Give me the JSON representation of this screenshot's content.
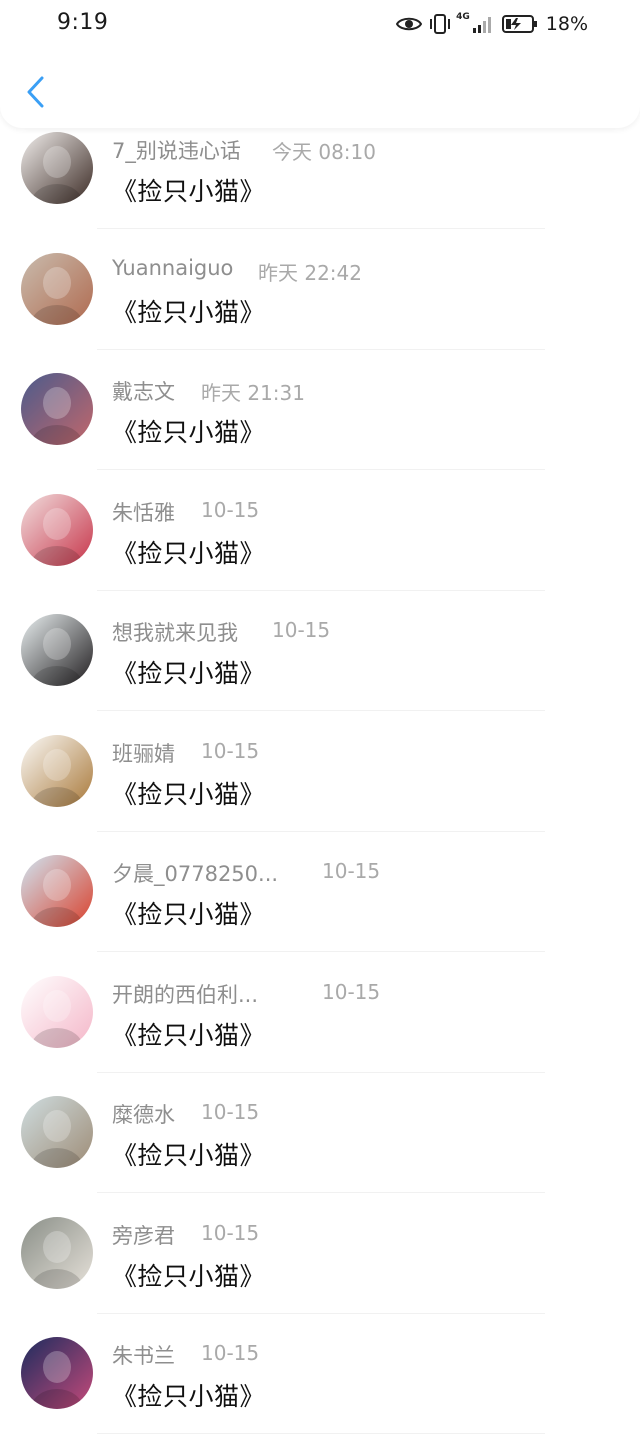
{
  "status_bar": {
    "time": "9:19",
    "network": "4G",
    "battery_percent": "18%"
  },
  "header": {
    "back_icon": "chevron-left-icon",
    "accent_color": "#3a9ff5"
  },
  "items": [
    {
      "name": "7_别说违心话",
      "time": "今天 08:10",
      "message": "《捡只小猫》",
      "avatar_colors": [
        "#f2efed",
        "#3b2a24"
      ]
    },
    {
      "name": "Yuannaiguo",
      "time": "昨天 22:42",
      "message": "《捡只小猫》",
      "avatar_colors": [
        "#c9bcae",
        "#b06a4f"
      ]
    },
    {
      "name": "戴志文",
      "time": "昨天 21:31",
      "message": "《捡只小猫》",
      "avatar_colors": [
        "#4b5b8c",
        "#c2676b"
      ]
    },
    {
      "name": "朱恬雅",
      "time": "10-15",
      "message": "《捡只小猫》",
      "avatar_colors": [
        "#f1dede",
        "#c7354a"
      ]
    },
    {
      "name": "想我就来见我",
      "time": "10-15",
      "message": "《捡只小猫》",
      "avatar_colors": [
        "#eaf0f1",
        "#201d1f"
      ]
    },
    {
      "name": "班骊婧",
      "time": "10-15",
      "message": "《捡只小猫》",
      "avatar_colors": [
        "#fbfaf8",
        "#a9793a"
      ]
    },
    {
      "name": "夕晨_0778250...",
      "time": "10-15",
      "message": "《捡只小猫》",
      "avatar_colors": [
        "#cfe5f2",
        "#d9412d"
      ]
    },
    {
      "name": "开朗的西伯利...",
      "time": "10-15",
      "message": "《捡只小猫》",
      "avatar_colors": [
        "#ffffff",
        "#f4b6c8"
      ]
    },
    {
      "name": "糜德水",
      "time": "10-15",
      "message": "《捡只小猫》",
      "avatar_colors": [
        "#cfdde0",
        "#9e8c76"
      ]
    },
    {
      "name": "旁彦君",
      "time": "10-15",
      "message": "《捡只小猫》",
      "avatar_colors": [
        "#8a8f88",
        "#e6e1d9"
      ]
    },
    {
      "name": "朱书兰",
      "time": "10-15",
      "message": "《捡只小猫》",
      "avatar_colors": [
        "#1c2c5e",
        "#c54a7a"
      ]
    }
  ]
}
